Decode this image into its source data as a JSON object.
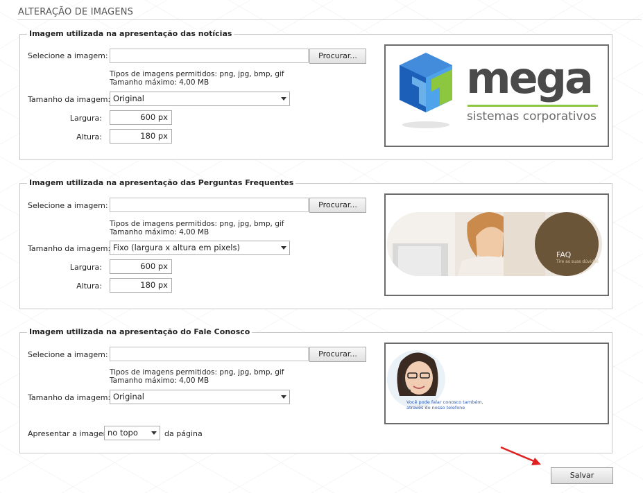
{
  "page": {
    "title": "ALTERAÇÃO DE IMAGENS"
  },
  "common": {
    "select_label": "Selecione a imagem:",
    "browse_label": "Procurar...",
    "allowed_types": "Tipos de imagens permitidos: png, jpg, bmp, gif",
    "max_size": "Tamanho máximo: 4,00 MB",
    "size_label": "Tamanho da imagem:",
    "width_label": "Largura:",
    "height_label": "Altura:"
  },
  "sections": [
    {
      "legend": "Imagem utilizada na apresentação das notícias",
      "size_value": "Original",
      "width_value": "600 px",
      "height_value": "180 px"
    },
    {
      "legend": "Imagem utilizada na apresentação das Perguntas Frequentes",
      "size_value": "Fixo (largura x altura em pixels)",
      "width_value": "600 px",
      "height_value": "180 px",
      "preview_title": "FAQ",
      "preview_subtitle": "Tire as suas dúvidas"
    },
    {
      "legend": "Imagem utilizada na apresentação do Fale Conosco",
      "size_value": "Original",
      "position_label": "Apresentar a imagem",
      "position_value": "no topo",
      "position_suffix": "da página",
      "preview_text_1": "Você pode falar conosco também,",
      "preview_text_2": "através do nosso telefone"
    }
  ],
  "logo": {
    "word": "mega",
    "tagline": "sistemas corporativos"
  },
  "footer": {
    "save_label": "Salvar"
  },
  "colors": {
    "accent_green": "#8dc63f",
    "logo_blue": "#2f7fd8",
    "arrow_red": "#e02020",
    "faq_brown": "#6b5538"
  }
}
